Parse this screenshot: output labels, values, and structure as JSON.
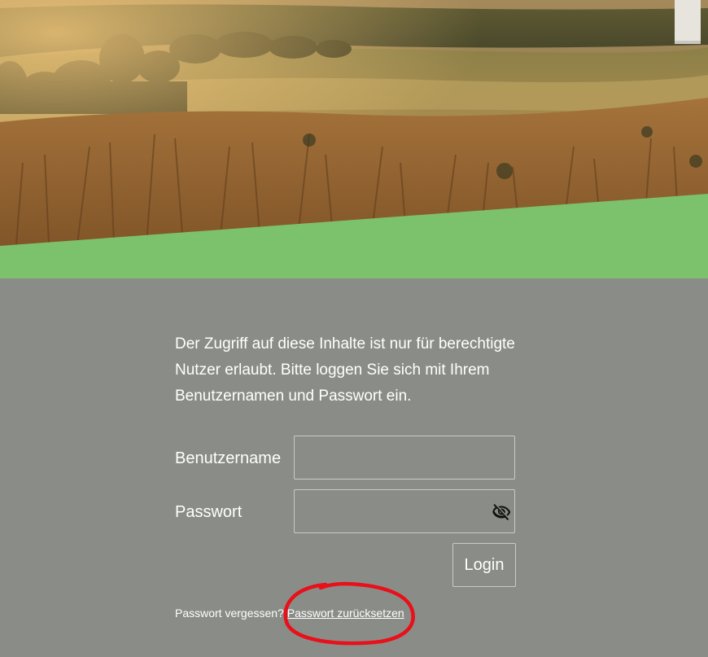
{
  "colors": {
    "background": "#8a8d87",
    "accent_green": "#7cc26c",
    "annotation_red": "#e8101a",
    "text": "#ffffff"
  },
  "hero": {
    "image": "field-landscape-photo"
  },
  "login": {
    "intro_text": "Der Zugriff auf diese Inhalte ist nur für berechtigte Nutzer erlaubt. Bitte loggen Sie sich mit Ihrem Benutzernamen und Passwort ein.",
    "username_label": "Benutzername",
    "username_value": "",
    "password_label": "Passwort",
    "password_value": "",
    "password_toggle_icon": "eye-slash-icon",
    "login_button": "Login",
    "forgot_text": "Passwort vergessen?",
    "reset_link": "Passwort zurücksetzen"
  }
}
